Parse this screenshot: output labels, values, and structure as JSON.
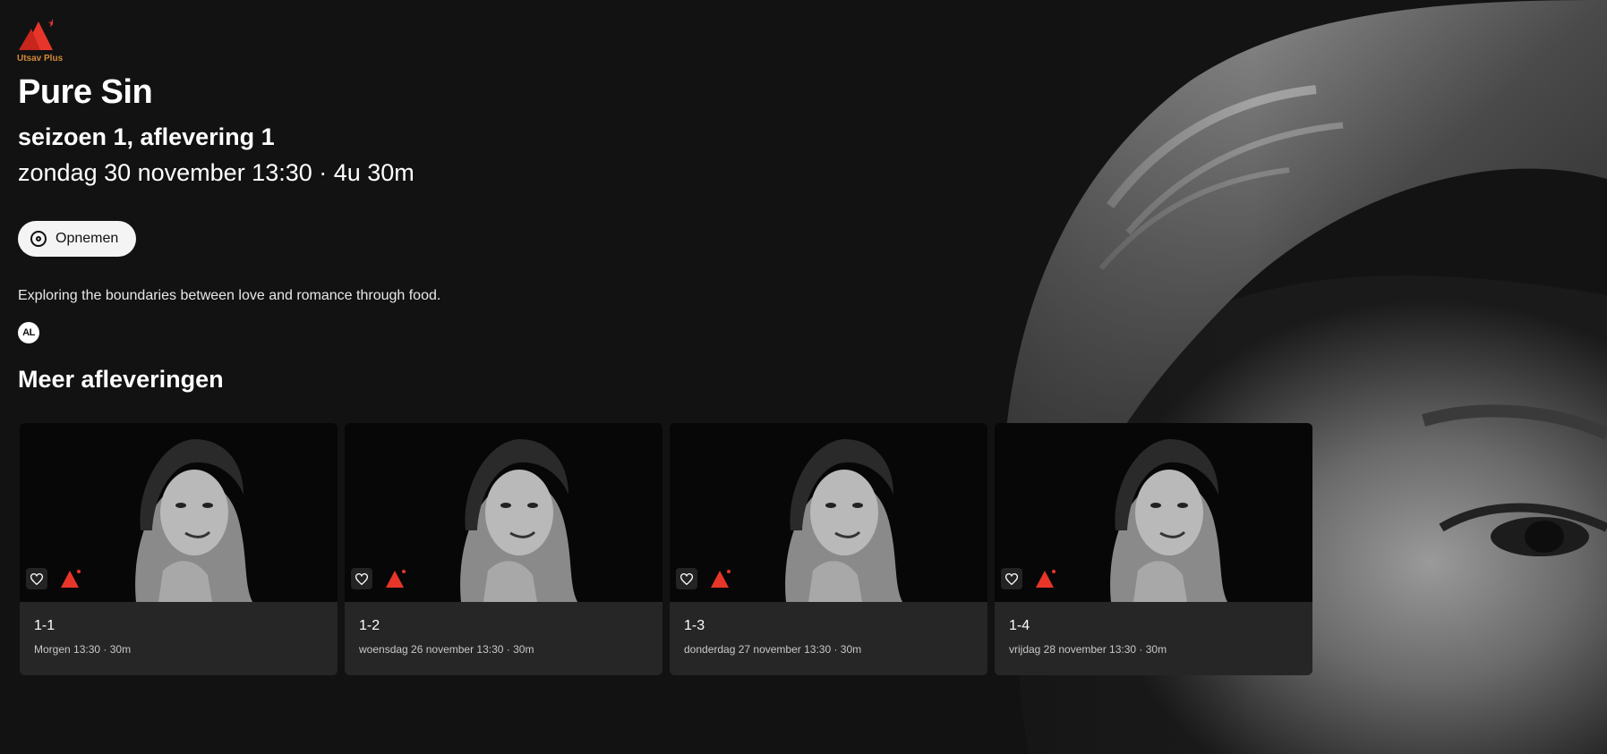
{
  "brand": {
    "name": "Utsav Plus",
    "accent": "#e8352a",
    "text_color": "#d48a3a"
  },
  "program": {
    "title": "Pure Sin",
    "episode": "seizoen 1, aflevering 1",
    "airtime": "zondag 30 november 13:30 · 4u 30m",
    "description": "Exploring the boundaries between love and romance through food.",
    "rating": "AL"
  },
  "actions": {
    "record_label": "Opnemen",
    "record_icon": "record-icon"
  },
  "more_episodes": {
    "heading": "Meer afleveringen",
    "items": [
      {
        "title": "1-1",
        "subtitle": "Morgen 13:30 · 30m",
        "channel": "Utsav Plus"
      },
      {
        "title": "1-2",
        "subtitle": "woensdag 26 november 13:30 · 30m",
        "channel": "Utsav Plus"
      },
      {
        "title": "1-3",
        "subtitle": "donderdag 27 november 13:30 · 30m",
        "channel": "Utsav Plus"
      },
      {
        "title": "1-4",
        "subtitle": "vrijdag 28 november 13:30 · 30m",
        "channel": "Utsav Plus"
      }
    ]
  }
}
